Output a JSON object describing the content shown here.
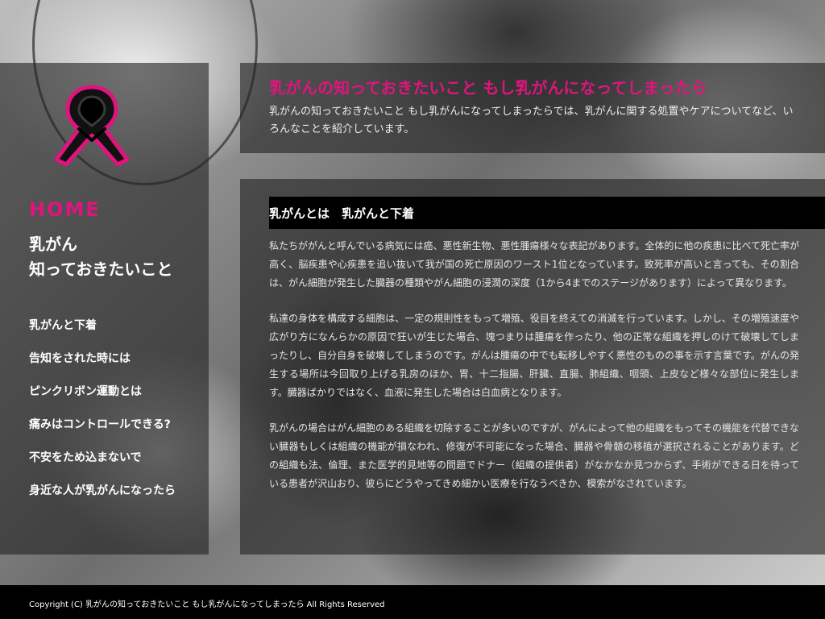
{
  "colors": {
    "accent": "#e0147e",
    "panel": "#232323",
    "footer_bg": "#000000",
    "text": "#ffffff"
  },
  "sidebar": {
    "logo_icon": "pink-ribbon-icon",
    "home_label": "HOME",
    "site_name_line1": "乳がん",
    "site_name_line2": "知っておきたいこと",
    "nav_items": [
      {
        "label": "乳がんと下着"
      },
      {
        "label": "告知をされた時には"
      },
      {
        "label": "ピンクリボン運動とは"
      },
      {
        "label": "痛みはコントロールできる?"
      },
      {
        "label": "不安をため込まないで"
      },
      {
        "label": "身近な人が乳がんになったら"
      }
    ]
  },
  "header": {
    "title": "乳がんの知っておきたいこと もし乳がんになってしまったら",
    "description": "乳がんの知っておきたいこと もし乳がんになってしまったらでは、乳がんに関する処置やケアについてなど、いろんなことを紹介しています。"
  },
  "main": {
    "section_title": "乳がんとは　乳がんと下着",
    "paragraphs": [
      "私たちががんと呼んでいる病気には癌、悪性新生物、悪性腫瘍様々な表記があります。全体的に他の疾患に比べて死亡率が高く、脳疾患や心疾患を追い抜いて我が国の死亡原因のワースト1位となっています。致死率が高いと言っても、その割合は、がん細胞が発生した臓器の種類やがん細胞の浸潤の深度（1から4までのステージがあります）によって異なります。",
      "私達の身体を構成する細胞は、一定の規則性をもって増殖、役目を終えての消滅を行っています。しかし、その増殖速度や広がり方になんらかの原因で狂いが生じた場合、塊つまりは腫瘍を作ったり、他の正常な組織を押しのけて破壊してしまったりし、自分自身を破壊してしまうのです。がんは腫瘍の中でも転移しやすく悪性のものの事を示す言葉です。がんの発生する場所は今回取り上げる乳房のほか、胃、十二指腸、肝臓、直腸、肺組織、咽頭、上皮など様々な部位に発生します。臓器ばかりではなく、血液に発生した場合は白血病となります。",
      "乳がんの場合はがん細胞のある組織を切除することが多いのですが、がんによって他の組織をもってその機能を代替できない臓器もしくは組織の機能が損なわれ、修復が不可能になった場合、臓器や骨髄の移植が選択されることがあります。どの組織も法、倫理、また医学的見地等の問題でドナー（組織の提供者）がなかなか見つからず、手術ができる日を待っている患者が沢山おり、彼らにどうやってきめ細かい医療を行なうべきか、模索がなされています。"
    ]
  },
  "footer": {
    "copyright": "Copyright (C) 乳がんの知っておきたいこと もし乳がんになってしまったら All Rights Reserved"
  }
}
